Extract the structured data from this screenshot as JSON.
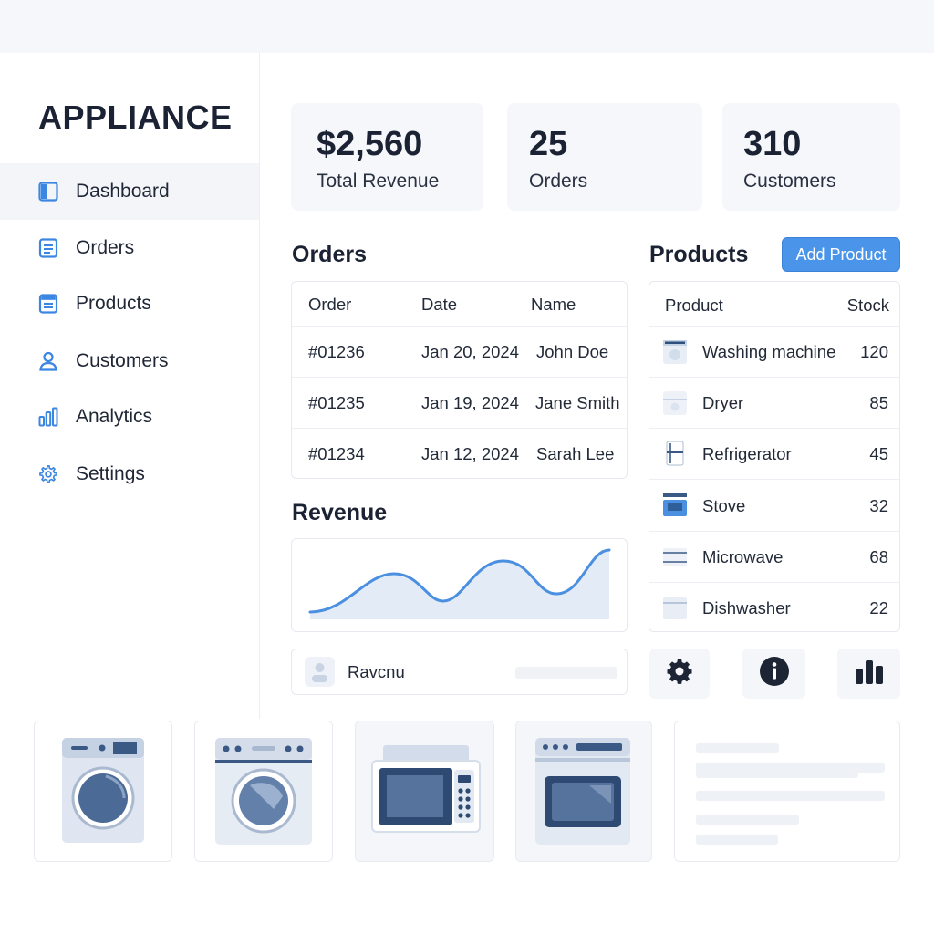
{
  "brand": "APPLIANCE",
  "nav": [
    {
      "label": "Dashboard",
      "icon": "dashboard-icon",
      "active": true
    },
    {
      "label": "Orders",
      "icon": "orders-icon"
    },
    {
      "label": "Products",
      "icon": "products-icon"
    },
    {
      "label": "Customers",
      "icon": "user-icon"
    },
    {
      "label": "Analytics",
      "icon": "bar-chart-icon"
    },
    {
      "label": "Settings",
      "icon": "gear-icon"
    }
  ],
  "stats": [
    {
      "value": "$2,560",
      "label": "Total Revenue"
    },
    {
      "value": "25",
      "label": "Orders"
    },
    {
      "value": "310",
      "label": "Customers"
    }
  ],
  "orders": {
    "title": "Orders",
    "columns": [
      "Order",
      "Date",
      "Name"
    ],
    "rows": [
      {
        "order": "#01236",
        "date": "Jan 20, 2024",
        "name": "John Doe"
      },
      {
        "order": "#01235",
        "date": "Jan 19, 2024",
        "name": "Jane Smith"
      },
      {
        "order": "#01234",
        "date": "Jan 12, 2024",
        "name": "Sarah Lee"
      }
    ]
  },
  "revenue": {
    "title": "Revenue",
    "line_color": "#4a8fe0",
    "fill_color": "#e3ebf7"
  },
  "user_row": {
    "name": "Ravcnu"
  },
  "products": {
    "title": "Products",
    "add_label": "Add Product",
    "columns": [
      "Product",
      "Stock"
    ],
    "rows": [
      {
        "name": "Washing machine",
        "stock": "120",
        "icon": "washing-machine-icon"
      },
      {
        "name": "Dryer",
        "stock": "85",
        "icon": "dryer-icon"
      },
      {
        "name": "Refrigerator",
        "stock": "45",
        "icon": "refrigerator-icon"
      },
      {
        "name": "Stove",
        "stock": "32",
        "icon": "stove-icon"
      },
      {
        "name": "Microwave",
        "stock": "68",
        "icon": "microwave-icon"
      },
      {
        "name": "Dishwasher",
        "stock": "22",
        "icon": "dishwasher-icon"
      }
    ]
  },
  "actions": [
    "gear-icon",
    "info-icon",
    "bar-chart-icon"
  ],
  "gallery": [
    "washing-machine-image",
    "dryer-image",
    "microwave-image",
    "oven-image",
    "placeholder-card"
  ],
  "colors": {
    "accent": "#4a95ea",
    "appliance_body": "#dfe6f1",
    "appliance_dark": "#3a5a85"
  }
}
